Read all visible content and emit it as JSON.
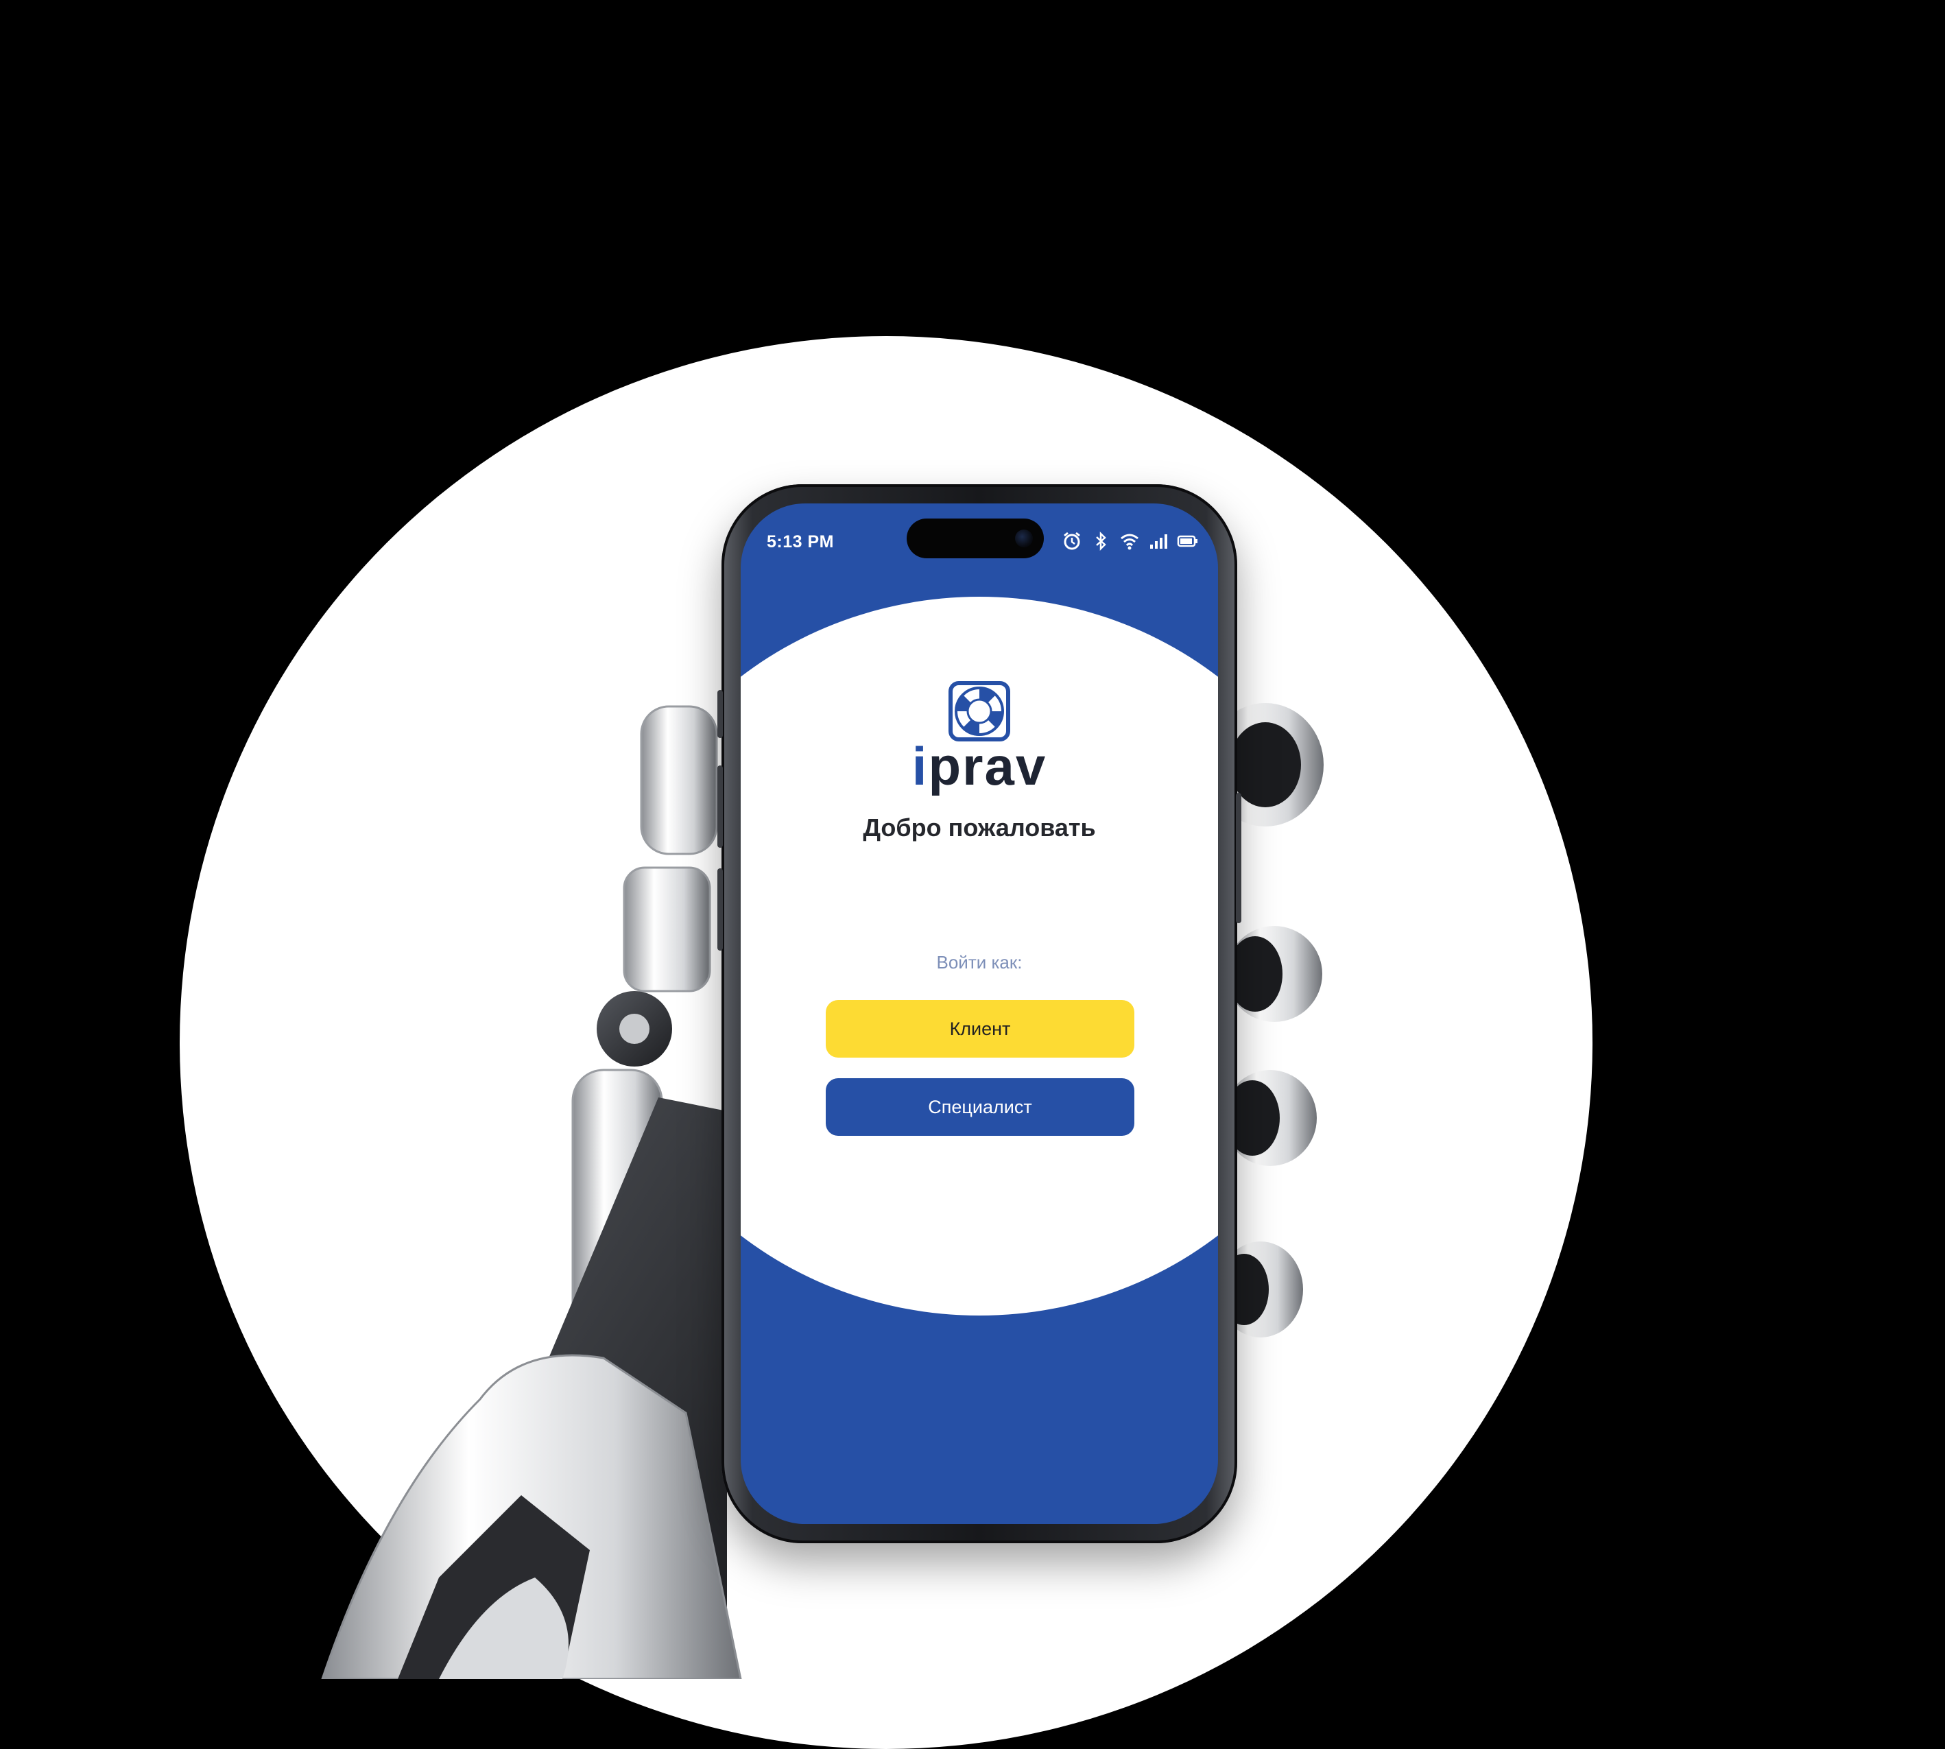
{
  "status_bar": {
    "time": "5:13 PM",
    "icons": [
      "alarm-icon",
      "bluetooth-icon",
      "wifi-icon",
      "signal-icon",
      "battery-icon"
    ]
  },
  "app": {
    "logo_prefix": "i",
    "logo_name": "prav",
    "welcome_title": "Добро пожаловать",
    "login_as_label": "Войти как:",
    "client_button": "Клиент",
    "specialist_button": "Специалист"
  },
  "colors": {
    "brand_blue": "#2650a6",
    "accent_yellow": "#fddb33",
    "background": "#000000",
    "halo": "#ffffff"
  }
}
